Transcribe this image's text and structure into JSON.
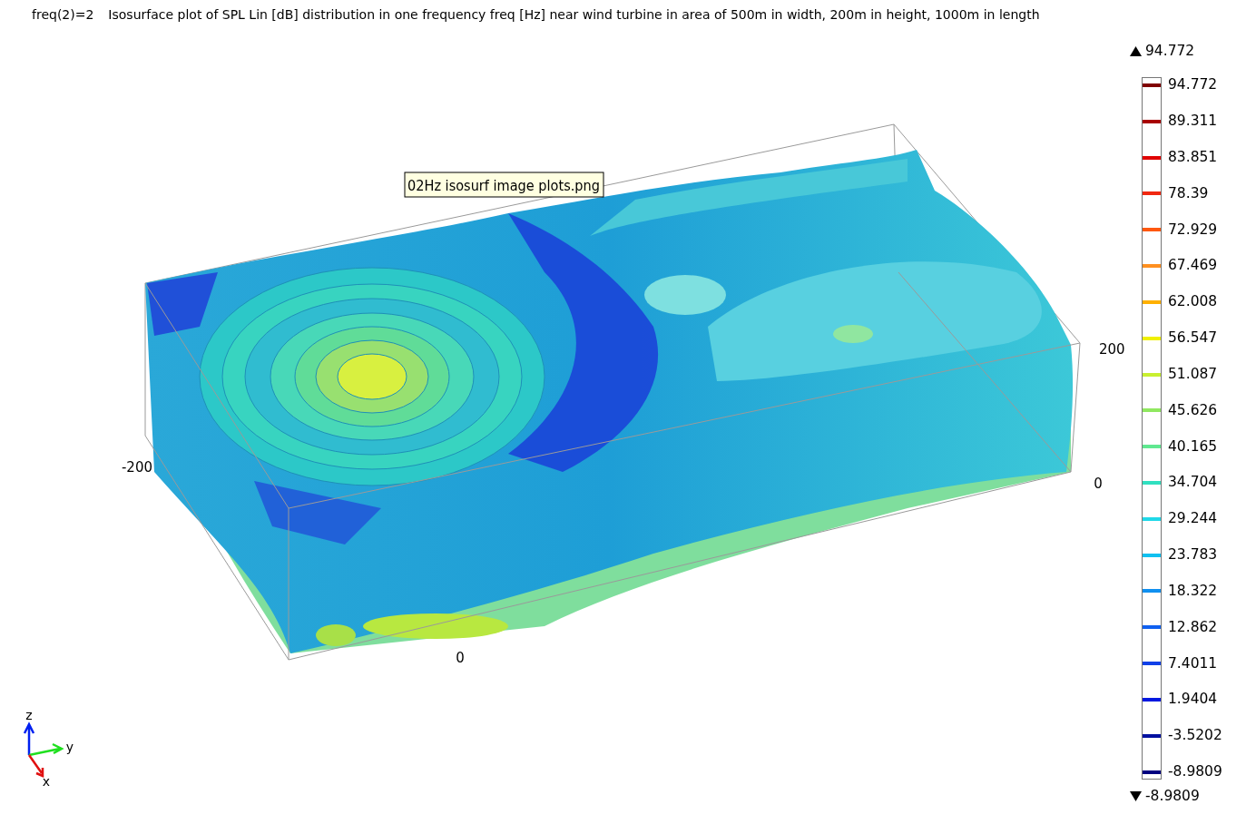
{
  "title": {
    "expression": "freq(2)=2",
    "text": "Isosurface plot of SPL Lin [dB] distribution in one frequency freq [Hz] near wind turbine in area of 500m in width, 200m in height, 1000m in length"
  },
  "tooltip": "02Hz isosurf image plots.png",
  "axis_labels": [
    "-200",
    "0",
    "200",
    "0"
  ],
  "triad": [
    "z",
    "y",
    "x"
  ],
  "color_legend": {
    "max": "94.772",
    "min": "-8.9809",
    "levels": [
      {
        "label": "94.772",
        "color": "#800000"
      },
      {
        "label": "89.311",
        "color": "#a80000"
      },
      {
        "label": "83.851",
        "color": "#e00000"
      },
      {
        "label": "78.39",
        "color": "#f02810"
      },
      {
        "label": "72.929",
        "color": "#ff5810"
      },
      {
        "label": "67.469",
        "color": "#ff9020"
      },
      {
        "label": "62.008",
        "color": "#ffb000"
      },
      {
        "label": "56.547",
        "color": "#f0f000"
      },
      {
        "label": "51.087",
        "color": "#c8f030"
      },
      {
        "label": "45.626",
        "color": "#90e860"
      },
      {
        "label": "40.165",
        "color": "#60e890"
      },
      {
        "label": "34.704",
        "color": "#30e0c0"
      },
      {
        "label": "29.244",
        "color": "#20d8e8"
      },
      {
        "label": "23.783",
        "color": "#10c0f0"
      },
      {
        "label": "18.322",
        "color": "#1090f0"
      },
      {
        "label": "12.862",
        "color": "#1060f0"
      },
      {
        "label": "7.4011",
        "color": "#1040e8"
      },
      {
        "label": "1.9404",
        "color": "#0018e0"
      },
      {
        "label": "-3.5202",
        "color": "#0010a0"
      },
      {
        "label": "-8.9809",
        "color": "#000080"
      }
    ]
  }
}
